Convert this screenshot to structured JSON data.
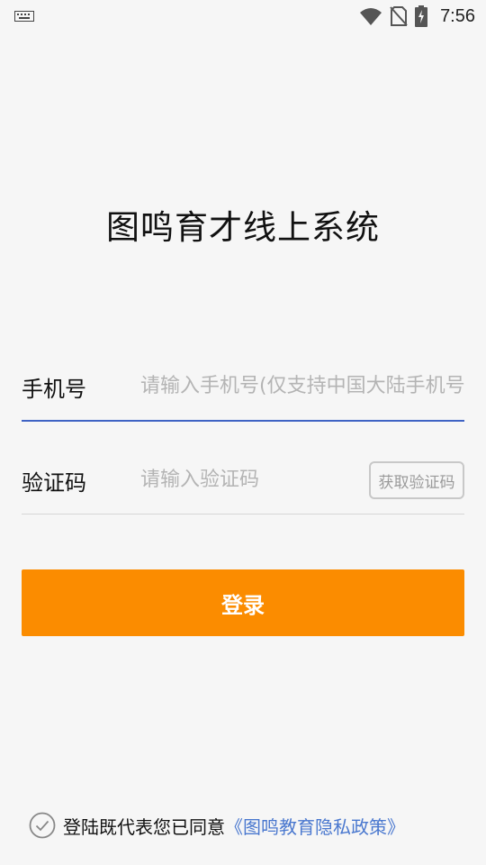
{
  "status_bar": {
    "time": "7:56",
    "icons": [
      "keyboard-icon",
      "wifi-icon",
      "no-sim-icon",
      "battery-charging-icon"
    ]
  },
  "app": {
    "title": "图鸣育才线上系统"
  },
  "form": {
    "phone": {
      "label": "手机号",
      "placeholder": "请输入手机号(仅支持中国大陆手机号)",
      "value": ""
    },
    "code": {
      "label": "验证码",
      "placeholder": "请输入验证码",
      "value": "",
      "get_code_label": "获取验证码"
    },
    "login_label": "登录"
  },
  "agreement": {
    "text": "登陆既代表您已同意",
    "link": "《图鸣教育隐私政策》",
    "checked": true
  },
  "colors": {
    "accent": "#fb8c00",
    "link": "#4a78cf",
    "focus_underline": "#3f63c4",
    "background": "#f6f6f6"
  }
}
